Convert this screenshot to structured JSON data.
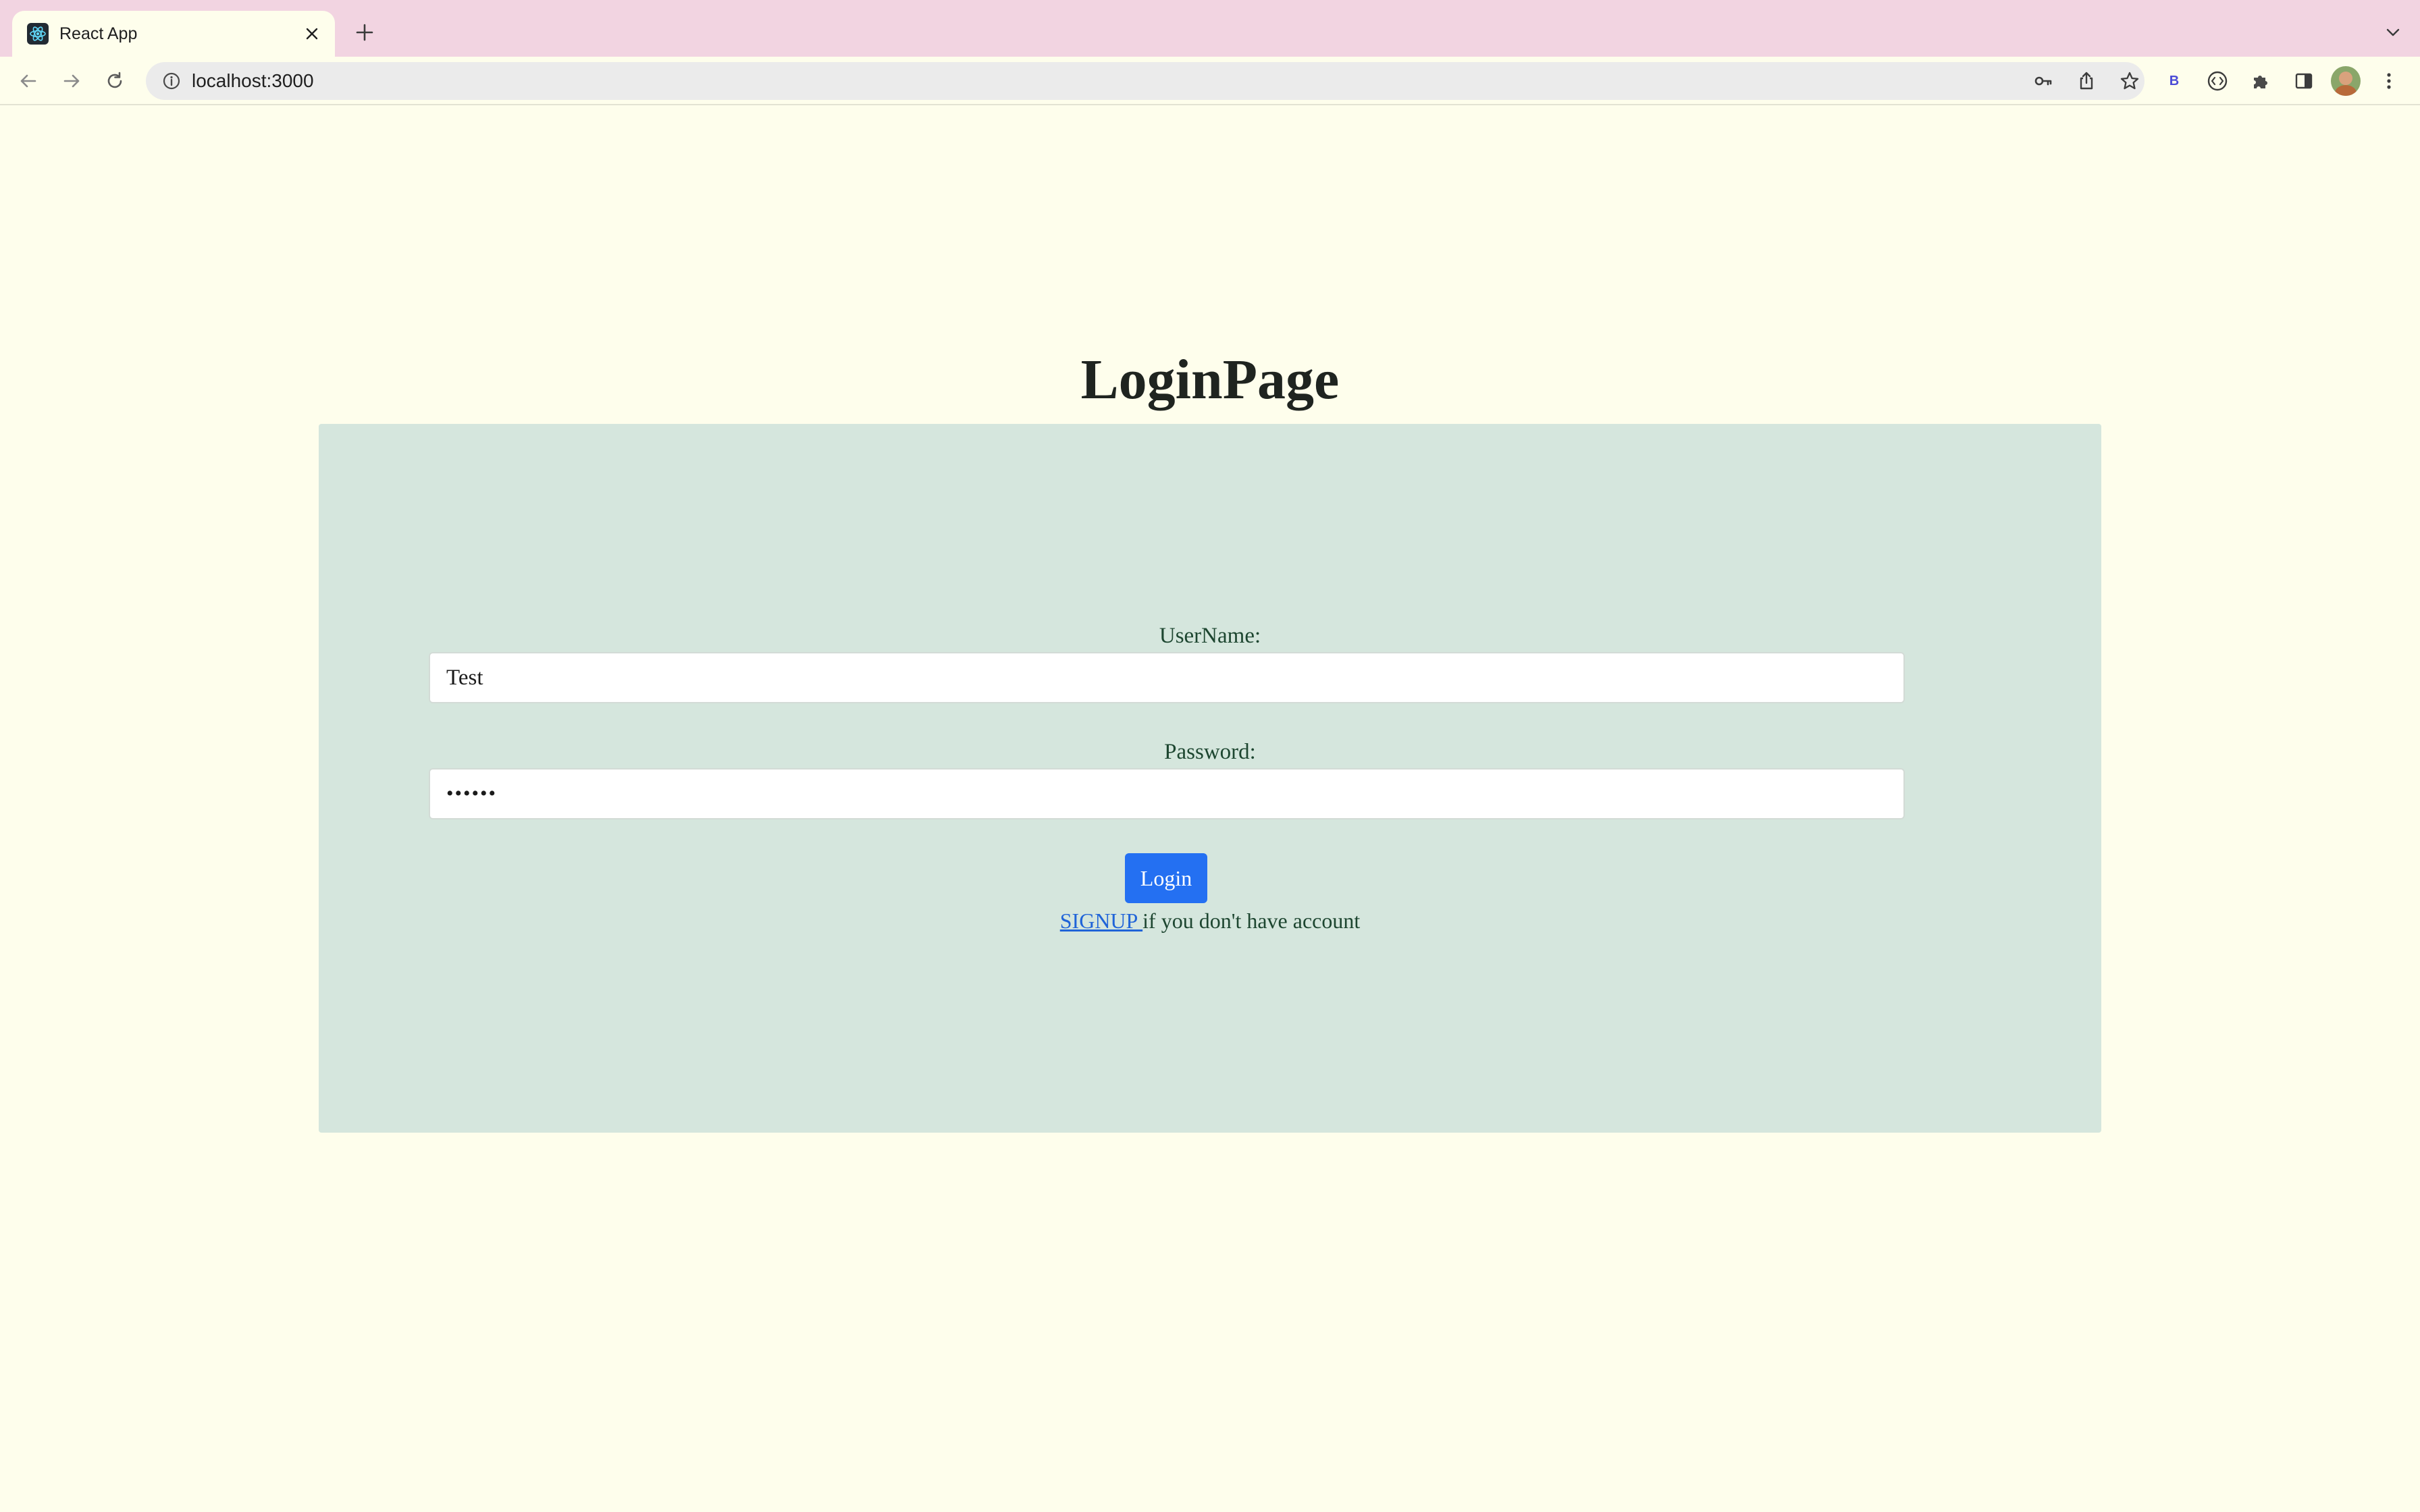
{
  "browser": {
    "tab": {
      "title": "React App",
      "favicon": "react-icon"
    },
    "url": "localhost:3000",
    "extension_label": "B",
    "icons": {
      "back": "arrow-left-icon",
      "forward": "arrow-right-icon",
      "reload": "reload-icon",
      "info": "info-icon",
      "password": "key-icon",
      "share": "share-icon",
      "bookmark": "star-icon",
      "extensions": "puzzle-icon",
      "sidepanel": "sidepanel-icon",
      "menu": "kebab-menu-icon"
    }
  },
  "page": {
    "title": "LoginPage",
    "username": {
      "label": "UserName:",
      "value": "Test"
    },
    "password": {
      "label": "Password:",
      "value": "••••••"
    },
    "login_button": "Login",
    "signup": {
      "link_text": "SIGNUP ",
      "suffix": "if you don't have account"
    }
  },
  "colors": {
    "page_background": "#fefeec",
    "tabstrip": "#f2d4e1",
    "panel": "#d5e6dd",
    "button": "#2470f2",
    "link": "#2064d8"
  }
}
